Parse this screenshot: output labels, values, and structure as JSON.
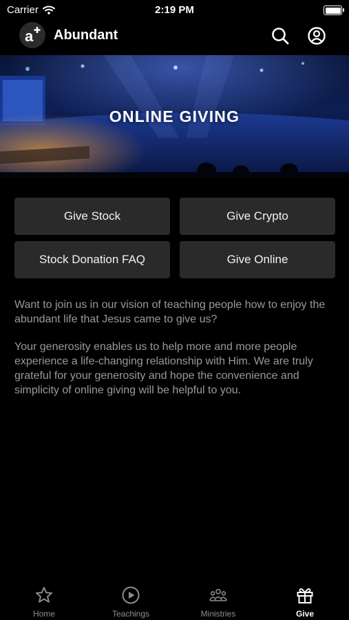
{
  "status_bar": {
    "carrier": "Carrier",
    "time": "2:19 PM"
  },
  "header": {
    "title": "Abundant",
    "logo_icon": "abundant-logo-icon",
    "search_icon": "search-icon",
    "profile_icon": "user-circle-icon"
  },
  "hero": {
    "title": "ONLINE GIVING"
  },
  "buttons": {
    "give_stock": "Give Stock",
    "give_crypto": "Give Crypto",
    "stock_faq": "Stock Donation FAQ",
    "give_online": "Give Online"
  },
  "content": {
    "paragraph1": "Want to join us in our vision of teaching people how to enjoy the abundant life that Jesus came to give us?",
    "paragraph2": "Your generosity enables us to help more and more people experience a life-changing relationship with Him. We are truly grateful for your generosity and hope the convenience and simplicity of online giving will be helpful to you."
  },
  "tabs": [
    {
      "label": "Home",
      "icon": "star-icon",
      "active": false
    },
    {
      "label": "Teachings",
      "icon": "play-circle-icon",
      "active": false
    },
    {
      "label": "Ministries",
      "icon": "people-group-icon",
      "active": false
    },
    {
      "label": "Give",
      "icon": "gift-icon",
      "active": true
    }
  ],
  "colors": {
    "background": "#000000",
    "button": "#2a2a2a",
    "body_text": "#9a9a9a",
    "inactive_tab": "#8e8e8e"
  }
}
